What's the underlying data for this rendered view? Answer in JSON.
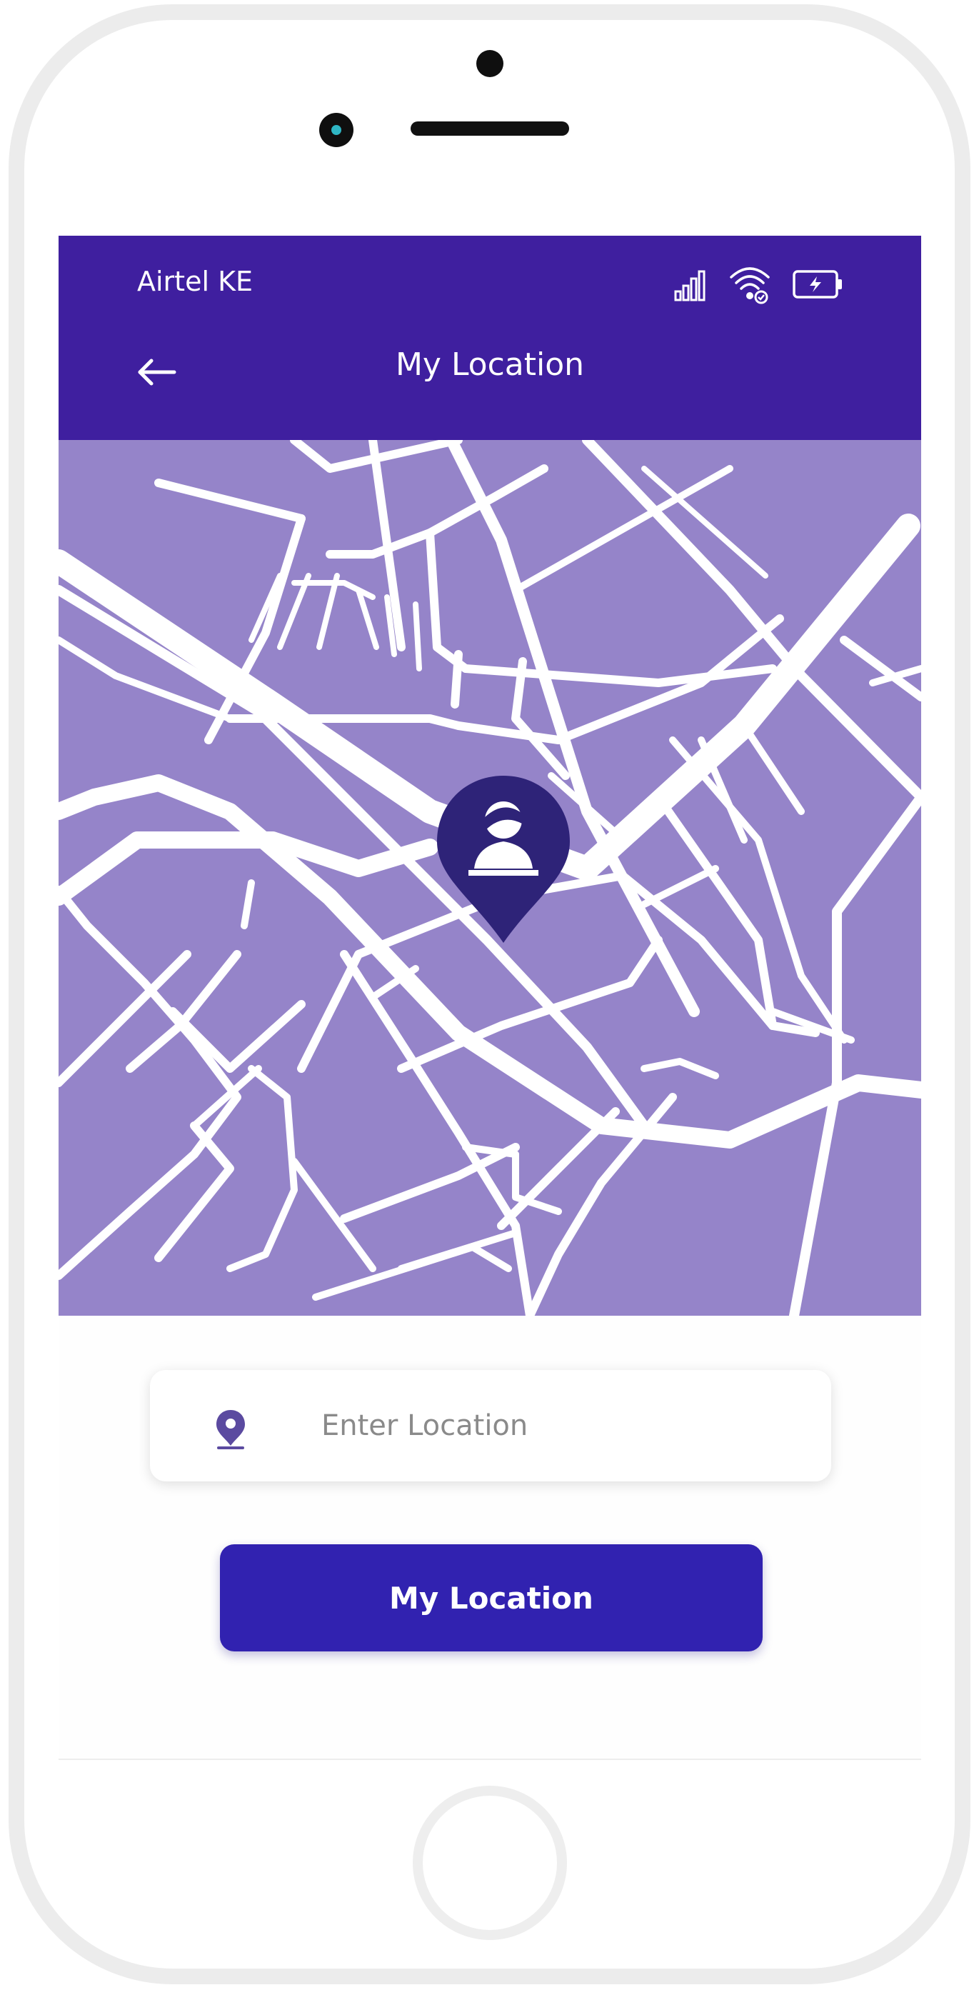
{
  "status_bar": {
    "carrier": "Airtel KE",
    "icons": [
      "signal-icon",
      "wifi-icon",
      "battery-icon"
    ]
  },
  "header": {
    "title": "My Location",
    "back_icon": "arrow-left-icon"
  },
  "map": {
    "marker_icon": "user-location-pin-icon"
  },
  "location_field": {
    "icon": "map-pin-icon",
    "placeholder": "Enter Location",
    "value": ""
  },
  "primary_button": {
    "label": "My Location"
  },
  "colors": {
    "header_bg": "#3f1f9f",
    "map_bg": "#9584c9",
    "map_roads": "#ffffff",
    "pin": "#2e2378",
    "button_bg": "#3122b0"
  }
}
